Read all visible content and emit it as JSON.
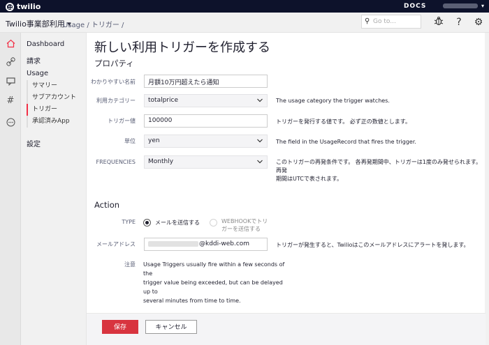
{
  "topbar": {
    "brand": "twilio",
    "docs": "DOCS",
    "account_caret": "▾"
  },
  "subbar": {
    "project": "Twilio事業部利用",
    "project_caret": "▾",
    "breadcrumb": "Usage  / トリガー  /",
    "search_placeholder": "Go to...",
    "icons": [
      "search-icon",
      "bug-icon",
      "help-icon",
      "gear-icon"
    ]
  },
  "rail": {
    "icons": [
      "home-icon",
      "link-icon",
      "message-icon",
      "hash-icon",
      "more-icon"
    ]
  },
  "sidebar": {
    "dashboard": "Dashboard",
    "billing": "請求",
    "usage": "Usage",
    "sub_items": [
      "サマリー",
      "サブアカウント",
      "トリガー",
      "承認済みApp"
    ],
    "settings": "設定"
  },
  "page": {
    "title": "新しい利用トリガーを作成する",
    "properties_heading": "プロパティ",
    "fields": {
      "name": {
        "label": "わかりやすい名前",
        "value": "月額10万円超えたら通知"
      },
      "category": {
        "label": "利用カテゴリー",
        "value": "totalprice",
        "help": "The usage category the trigger watches."
      },
      "trigger_value": {
        "label": "トリガー値",
        "value": "100000",
        "help": "トリガーを発行する値です。 必ず正の数値とします。"
      },
      "unit": {
        "label": "単位",
        "value": "yen",
        "help": "The field in the UsageRecord that fires the trigger."
      },
      "frequencies": {
        "label": "FREQUENCIES",
        "value": "Monthly",
        "help_line1": "このトリガーの再発条件です。 各再発期間中、トリガーは1度のみ発せられます。 再発",
        "help_line2": "期間はUTCで表されます。"
      }
    },
    "action_heading": "Action",
    "type": {
      "label": "TYPE",
      "option_email": "メールを送信する",
      "option_webhook_line1": "WEBHOOKでトリ",
      "option_webhook_line2": "ガーを送信する"
    },
    "email": {
      "label": "メールアドレス",
      "value_domain": "@kddi-web.com",
      "help": "トリガーが発生すると、Twilioはこのメールアドレスにアラートを発します。"
    },
    "notes": {
      "label": "注意",
      "line1": "Usage Triggers usually fire within a few seconds of the",
      "line2": "trigger value being exceeded, but can be delayed up to",
      "line3": "several minutes from time to time."
    },
    "footer": {
      "save": "保存",
      "cancel": "キャンセル"
    }
  },
  "colors": {
    "topbar": "#0d122b",
    "accent": "#f22f46",
    "save_button": "#d8343f"
  }
}
